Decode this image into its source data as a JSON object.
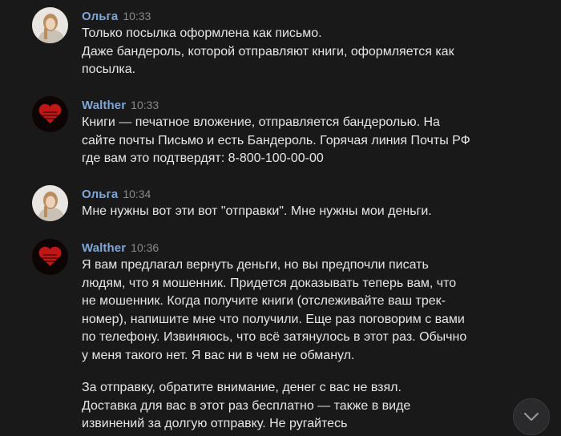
{
  "messages": [
    {
      "author": "Ольга",
      "time": "10:33",
      "lines": [
        "Только посылка оформлена как письмо.",
        "Даже бандероль, которой отправляют книги, оформляется как",
        "посылка."
      ]
    },
    {
      "author": "Walther",
      "time": "10:33",
      "lines": [
        "Книги — печатное вложение, отправляется бандеролью. На",
        "сайте почты Письмо и есть Бандероль. Горячая линия Почты РФ",
        "где вам это подтвердят: 8-800-100-00-00"
      ]
    },
    {
      "author": "Ольга",
      "time": "10:34",
      "lines": [
        "Мне нужны вот эти вот \"отправки\". Мне нужны мои деньги."
      ]
    },
    {
      "author": "Walther",
      "time": "10:36",
      "lines": [
        "Я вам предлагал вернуть деньги, но вы предпочли писать",
        "людям, что я мошенник. Придется доказывать теперь вам, что",
        "не мошенник. Когда получите книги (отслеживайте ваш трек-",
        "номер), напишите мне что получили. Еще раз поговорим с вами",
        "по телефону. Извиняюсь, что всё затянулось в этот раз. Обычно",
        "у меня такого нет. Я вас ни в чем не обманул."
      ],
      "lines2": [
        "За отправку, обратите внимание, денег с вас не взял.",
        "Доставка для вас в этот раз бесплатно — также в виде",
        "извинений за долгую отправку. Не ругайтесь"
      ]
    }
  ],
  "scroll_button": {
    "icon": "chevron-down-icon"
  },
  "colors": {
    "background": "#19191a",
    "author": "#7fa6d6",
    "text": "#e6e6e6",
    "time": "#8a8a8a"
  }
}
